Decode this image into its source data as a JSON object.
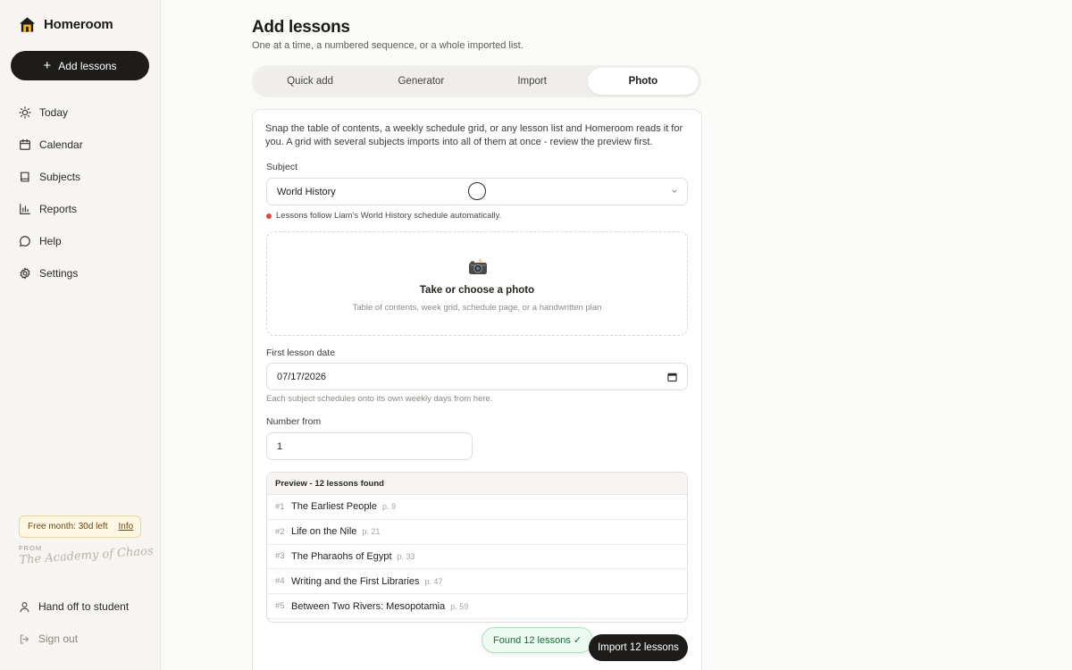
{
  "app": {
    "name": "Homeroom"
  },
  "sidebar": {
    "add_label": "Add lessons",
    "items": [
      {
        "label": "Today",
        "icon": "sun-icon"
      },
      {
        "label": "Calendar",
        "icon": "calendar-icon"
      },
      {
        "label": "Subjects",
        "icon": "book-icon"
      },
      {
        "label": "Reports",
        "icon": "bar-chart-icon"
      },
      {
        "label": "Help",
        "icon": "chat-bubble-icon"
      },
      {
        "label": "Settings",
        "icon": "gear-icon"
      }
    ],
    "trial": {
      "text": "Free month: 30d left",
      "link": "Info"
    },
    "from_label": "FROM",
    "signature": "The Academy of Chaos",
    "handoff": "Hand off to student",
    "signout": "Sign out"
  },
  "page": {
    "title": "Add lessons",
    "subtitle": "One at a time, a numbered sequence, or a whole imported list."
  },
  "tabs": [
    {
      "label": "Quick add",
      "active": false
    },
    {
      "label": "Generator",
      "active": false
    },
    {
      "label": "Import",
      "active": false
    },
    {
      "label": "Photo",
      "active": true
    }
  ],
  "form": {
    "intro": "Snap the table of contents, a weekly schedule grid, or any lesson list and Homeroom reads it for you. A grid with several subjects imports into all of them at once - review the preview first.",
    "subject_label": "Subject",
    "subject_value": "World History",
    "subject_hint": "Lessons follow Liam's World History schedule automatically.",
    "photo_title": "Take or choose a photo",
    "photo_sub": "Table of contents, week grid, schedule page, or a handwritten plan",
    "date_label": "First lesson date",
    "date_value": "07/17/2026",
    "date_note": "Each subject schedules onto its own weekly days from here.",
    "number_label": "Number from",
    "number_value": "1"
  },
  "preview": {
    "header": "Preview - 12 lessons found",
    "rows": [
      {
        "num": "#1",
        "name": "The Earliest People",
        "page": "p. 9"
      },
      {
        "num": "#2",
        "name": "Life on the Nile",
        "page": "p. 21"
      },
      {
        "num": "#3",
        "name": "The Pharaohs of Egypt",
        "page": "p. 33"
      },
      {
        "num": "#4",
        "name": "Writing and the First Libraries",
        "page": "p. 47"
      },
      {
        "num": "#5",
        "name": "Between Two Rivers: Mesopotamia",
        "page": "p. 59"
      }
    ]
  },
  "toast": "Found 12 lessons ✓",
  "import_label": "Import 12 lessons",
  "colors": {
    "accent": "#1d1c1a",
    "success_bg": "#ecfaf1",
    "success_text": "#1f6b3c",
    "warning_bg": "#fdf6e3"
  }
}
